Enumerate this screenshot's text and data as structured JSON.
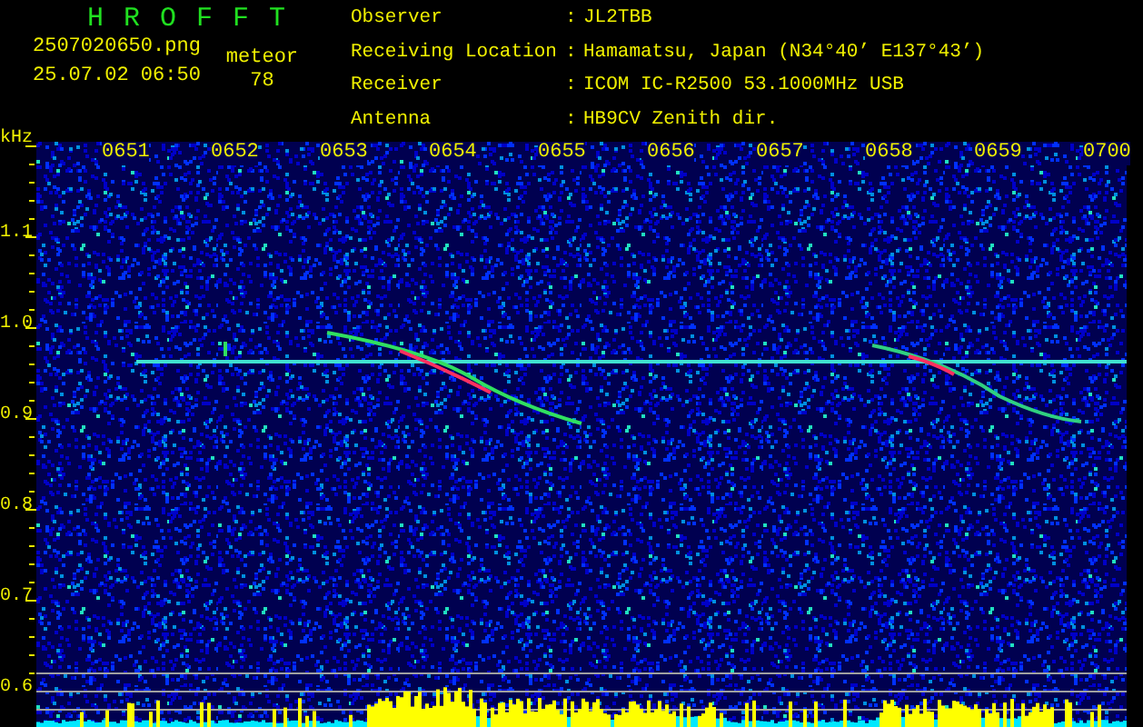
{
  "header": {
    "title": "H R O F F T",
    "file_name": "2507020650.png",
    "date_time": "25.07.02 06:50",
    "count_label": "meteor",
    "count": "78"
  },
  "info": [
    {
      "label": "Observer",
      "colon": ":",
      "value": "JL2TBB"
    },
    {
      "label": "Receiving Location",
      "colon": ":",
      "value": "Hamamatsu, Japan (N34°40’ E137°43’)"
    },
    {
      "label": "Receiver",
      "colon": ":",
      "value": "ICOM IC-R2500 53.1000MHz USB"
    },
    {
      "label": "Antenna",
      "colon": ":",
      "value": "HB9CV Zenith dir."
    }
  ],
  "plot": {
    "unit": "kHz",
    "time_ticks": [
      "0651",
      "0652",
      "0653",
      "0654",
      "0655",
      "0656",
      "0657",
      "0658",
      "0659",
      "0700"
    ],
    "freq_ticks": [
      "1.1",
      "1.0",
      "0.9",
      "0.8",
      "0.7",
      "0.6"
    ]
  }
}
